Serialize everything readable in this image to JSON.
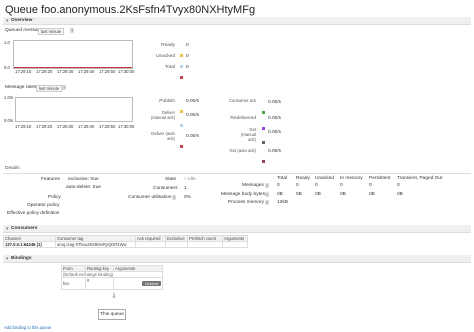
{
  "page": {
    "title": "Queue foo.anonymous.2KsFsfn4Tvyx80NXHtyMFg"
  },
  "overview": {
    "section_label": "Overview",
    "queued_messages": {
      "label": "Queued messages",
      "range": "last minute",
      "help": "?",
      "y_top": "1.0",
      "y_bottom": "0.0",
      "x_ticks": [
        "17:29:10",
        "17:29:20",
        "17:29:30",
        "17:29:40",
        "17:29:50",
        "17:30:00"
      ],
      "legend": [
        {
          "label": "Ready",
          "value": "0",
          "color": "#edc240"
        },
        {
          "label": "Unacked",
          "value": "0",
          "color": "#afd8f8"
        },
        {
          "label": "Total",
          "value": "0",
          "color": "#cb4b4b"
        }
      ]
    },
    "message_rates": {
      "label": "Message rates",
      "range": "last minute",
      "help": "?",
      "y_top": "1.0/s",
      "y_bottom": "0.0/s",
      "x_ticks": [
        "17:29:10",
        "17:29:20",
        "17:29:30",
        "17:29:40",
        "17:29:50",
        "17:30:00"
      ],
      "legend_left": [
        {
          "label": "Publish",
          "value": "0.00/s",
          "color": "#edc240"
        },
        {
          "label": "Deliver (manual ack)",
          "value": "0.00/s",
          "color": "#afd8f8"
        },
        {
          "label": "Deliver (auto ack)",
          "value": "0.00/s",
          "color": "#cb4b4b"
        }
      ],
      "legend_right": [
        {
          "label": "Consumer ack",
          "value": "0.00/s",
          "color": "#4da74d"
        },
        {
          "label": "Redelivered",
          "value": "0.00/s",
          "color": "#9440ed"
        },
        {
          "label": "Get (manual ack)",
          "value": "0.00/s",
          "color": "#666666"
        },
        {
          "label": "Get (auto ack)",
          "value": "0.00/s",
          "color": "#8d4653"
        }
      ]
    }
  },
  "details": {
    "label": "Details",
    "features_label": "Features",
    "features": [
      "exclusive: true",
      "auto-delete: true"
    ],
    "policy_label": "Policy",
    "operator_policy_label": "Operator policy",
    "effective_policy_label": "Effective policy definition",
    "state_label": "State",
    "state_value": "idle",
    "consumers_label": "Consumers",
    "consumers_value": "1",
    "consumer_util_label": "Consumer utilisation",
    "consumer_util_help": "?",
    "consumer_util_value": "0%",
    "stats_headers": [
      "Total",
      "Ready",
      "Unacked",
      "In memory",
      "Persistent",
      "Transient, Paged Out"
    ],
    "stats_rows": [
      {
        "label": "Messages",
        "help": "?",
        "values": [
          "0",
          "0",
          "0",
          "0",
          "0",
          "0"
        ]
      },
      {
        "label": "Message body bytes",
        "help": "?",
        "values": [
          "0B",
          "0B",
          "0B",
          "0B",
          "0B",
          "0B"
        ]
      },
      {
        "label": "Process memory",
        "help": "?",
        "values": [
          "12kB"
        ]
      }
    ]
  },
  "consumers": {
    "label": "Consumers",
    "headers": [
      "Channel",
      "Consumer tag",
      "Ack required",
      "Exclusive",
      "Prefetch count",
      "Arguments"
    ],
    "rows": [
      {
        "channel": "127.0.0.1:64246 (1)",
        "tag": "amq.ctag-0TbvuZ62BMvRyQDR4Ww",
        "ack": "",
        "exclusive": "",
        "prefetch": "",
        "arguments": ""
      }
    ]
  },
  "bindings": {
    "label": "Bindings",
    "headers": [
      "From",
      "Routing key",
      "Arguments"
    ],
    "default_row": "(Default exchange binding)",
    "row": {
      "from": "foo",
      "routing_key": "#",
      "arguments": ""
    },
    "unbind_label": "Unbind",
    "arrow": "⇓",
    "this_queue": "This queue"
  },
  "footer": {
    "text": "Add binding to this queue"
  },
  "colors": {
    "total_line": "#cc3333",
    "section_bg": "#f0f0f0"
  }
}
